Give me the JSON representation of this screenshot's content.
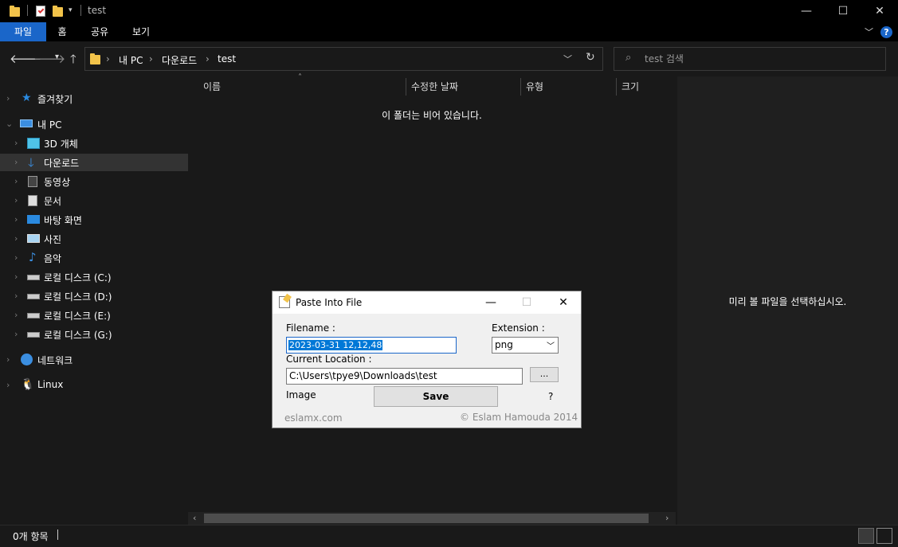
{
  "window": {
    "title": "test",
    "minimize": "—",
    "maximize": "☐",
    "close": "✕"
  },
  "ribbon": {
    "tabs": [
      "파일",
      "홈",
      "공유",
      "보기"
    ],
    "collapse_icon": "chevron-down",
    "help": "?"
  },
  "address": {
    "crumbs": [
      "내 PC",
      "다운로드",
      "test"
    ]
  },
  "search": {
    "placeholder": "test 검색"
  },
  "nav": {
    "items": [
      {
        "label": "즐겨찾기",
        "icon": "star-icon"
      },
      {
        "label": "내 PC",
        "icon": "pc-icon"
      },
      {
        "label": "3D 개체",
        "icon": "cube-icon"
      },
      {
        "label": "다운로드",
        "icon": "download-icon"
      },
      {
        "label": "동영상",
        "icon": "video-icon"
      },
      {
        "label": "문서",
        "icon": "document-icon"
      },
      {
        "label": "바탕 화면",
        "icon": "desktop-icon"
      },
      {
        "label": "사진",
        "icon": "pictures-icon"
      },
      {
        "label": "음악",
        "icon": "music-icon"
      },
      {
        "label": "로컬 디스크 (C:)",
        "icon": "drive-icon"
      },
      {
        "label": "로컬 디스크 (D:)",
        "icon": "drive-icon"
      },
      {
        "label": "로컬 디스크 (E:)",
        "icon": "drive-icon"
      },
      {
        "label": "로컬 디스크 (G:)",
        "icon": "drive-icon"
      },
      {
        "label": "네트워크",
        "icon": "network-icon"
      },
      {
        "label": "Linux",
        "icon": "linux-icon"
      }
    ]
  },
  "content": {
    "columns": [
      "이름",
      "수정한 날짜",
      "유형",
      "크기"
    ],
    "empty_message": "이 폴더는 비어 있습니다."
  },
  "preview": {
    "message": "미리 볼 파일을 선택하십시오."
  },
  "status": {
    "items_count": "0개 항목"
  },
  "dialog": {
    "title": "Paste Into File",
    "filename_label": "Filename :",
    "filename_value": "2023-03-31 12,12,48",
    "extension_label": "Extension :",
    "extension_value": "png",
    "location_label": "Current Location :",
    "location_value": "C:\\Users\\tpye9\\Downloads\\test",
    "browse_label": "...",
    "type_label": "Image",
    "save_label": "Save",
    "help_label": "?",
    "site": "eslamx.com",
    "copyright": "© Eslam Hamouda 2014",
    "minimize": "—",
    "maximize": "☐",
    "close": "✕"
  }
}
